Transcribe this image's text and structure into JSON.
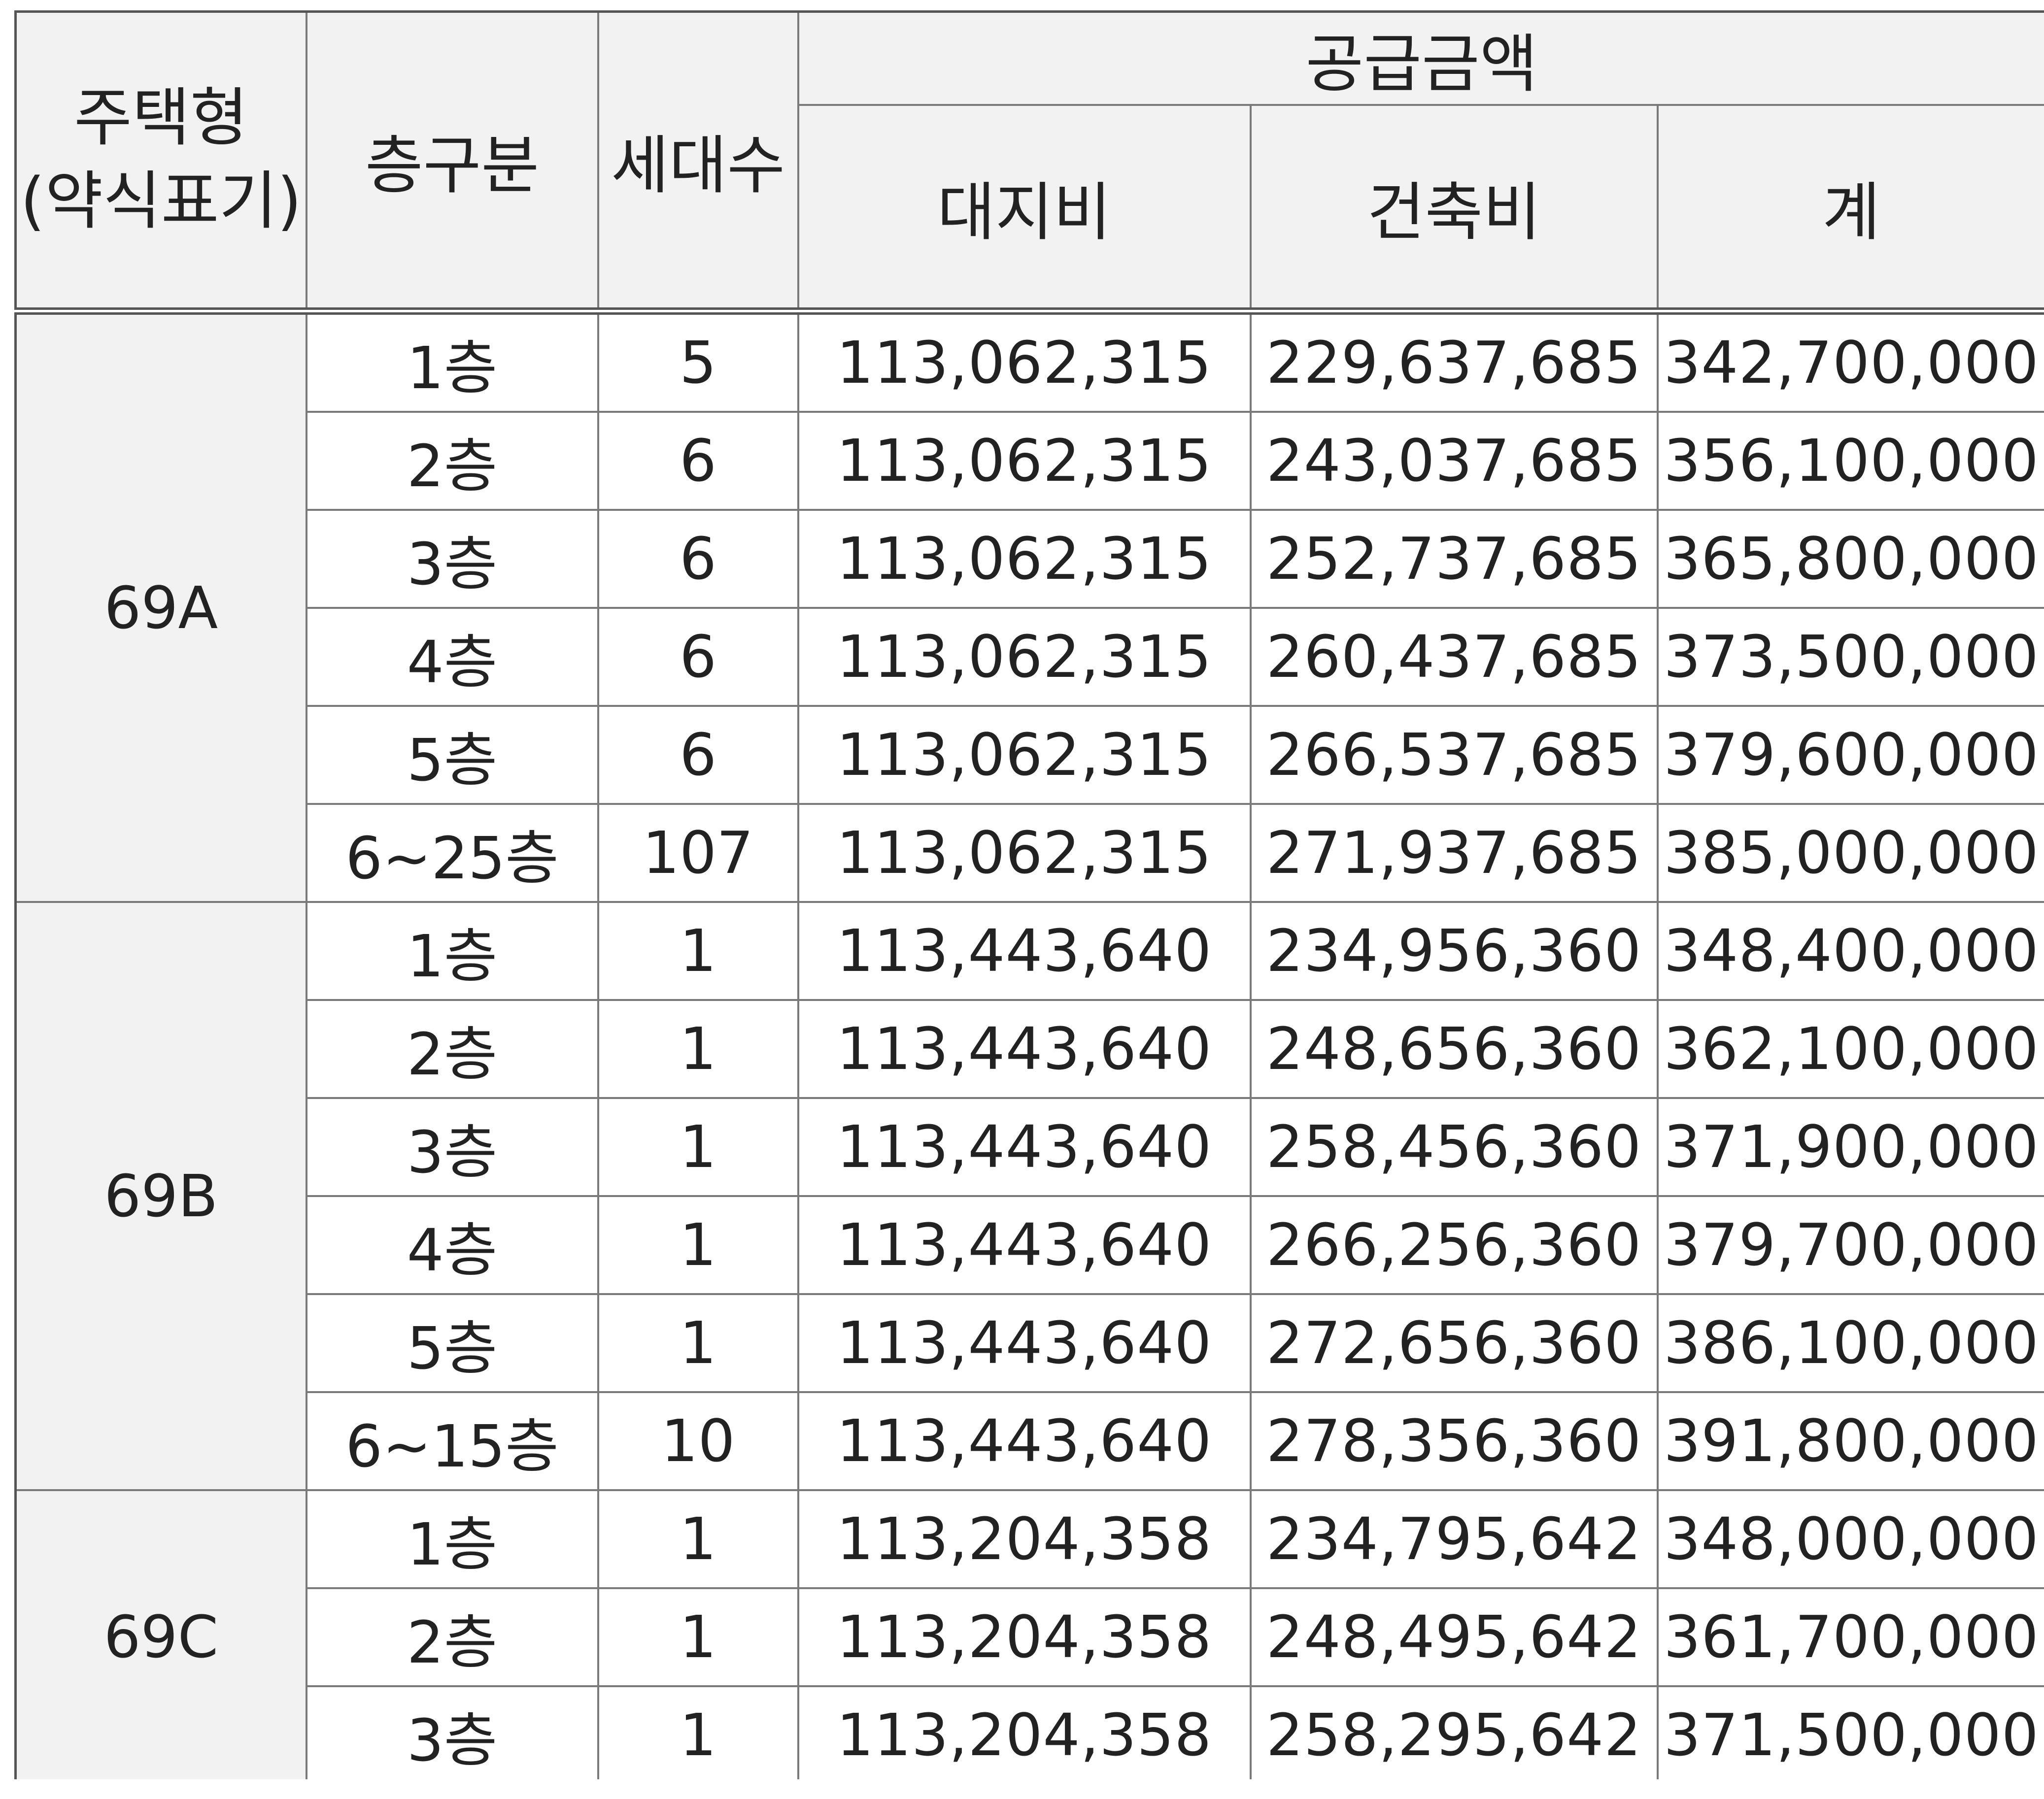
{
  "header": {
    "type_line1": "주택형",
    "type_line2": "(약식표기)",
    "floor": "층구분",
    "households": "세대수",
    "supply_group": "공급금액",
    "land": "대지비",
    "building": "건축비",
    "total": "계"
  },
  "groups": [
    {
      "type": "69A",
      "rows": [
        {
          "floor": "1층",
          "households": "5",
          "land": "113,062,315",
          "building": "229,637,685",
          "total": "342,700,000"
        },
        {
          "floor": "2층",
          "households": "6",
          "land": "113,062,315",
          "building": "243,037,685",
          "total": "356,100,000"
        },
        {
          "floor": "3층",
          "households": "6",
          "land": "113,062,315",
          "building": "252,737,685",
          "total": "365,800,000"
        },
        {
          "floor": "4층",
          "households": "6",
          "land": "113,062,315",
          "building": "260,437,685",
          "total": "373,500,000"
        },
        {
          "floor": "5층",
          "households": "6",
          "land": "113,062,315",
          "building": "266,537,685",
          "total": "379,600,000"
        },
        {
          "floor": "6~25층",
          "households": "107",
          "land": "113,062,315",
          "building": "271,937,685",
          "total": "385,000,000"
        }
      ]
    },
    {
      "type": "69B",
      "rows": [
        {
          "floor": "1층",
          "households": "1",
          "land": "113,443,640",
          "building": "234,956,360",
          "total": "348,400,000"
        },
        {
          "floor": "2층",
          "households": "1",
          "land": "113,443,640",
          "building": "248,656,360",
          "total": "362,100,000"
        },
        {
          "floor": "3층",
          "households": "1",
          "land": "113,443,640",
          "building": "258,456,360",
          "total": "371,900,000"
        },
        {
          "floor": "4층",
          "households": "1",
          "land": "113,443,640",
          "building": "266,256,360",
          "total": "379,700,000"
        },
        {
          "floor": "5층",
          "households": "1",
          "land": "113,443,640",
          "building": "272,656,360",
          "total": "386,100,000"
        },
        {
          "floor": "6~15층",
          "households": "10",
          "land": "113,443,640",
          "building": "278,356,360",
          "total": "391,800,000"
        }
      ]
    },
    {
      "type": "69C",
      "rows": [
        {
          "floor": "1층",
          "households": "1",
          "land": "113,204,358",
          "building": "234,795,642",
          "total": "348,000,000"
        },
        {
          "floor": "2층",
          "households": "1",
          "land": "113,204,358",
          "building": "248,495,642",
          "total": "361,700,000"
        },
        {
          "floor": "3층",
          "households": "1",
          "land": "113,204,358",
          "building": "258,295,642",
          "total": "371,500,000"
        }
      ]
    }
  ]
}
